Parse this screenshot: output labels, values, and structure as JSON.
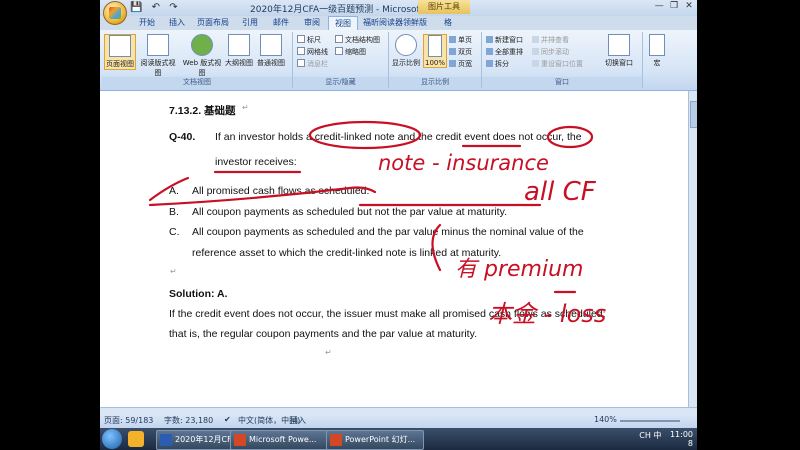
{
  "window": {
    "title": "2020年12月CFA一级百题预测 - Microsoft Word",
    "contextual_tab": "图片工具",
    "quick_access": [
      "save-icon",
      "undo-icon",
      "redo-icon"
    ]
  },
  "tabs": [
    "开始",
    "插入",
    "页面布局",
    "引用",
    "邮件",
    "审阅",
    "视图",
    "福昕阅读器领鲜版",
    "格"
  ],
  "active_tab": "视图",
  "ribbon": {
    "doc_views": {
      "buttons": [
        "页面视图",
        "阅读版式视图",
        "Web 版式视图",
        "大纲视图",
        "普通视图"
      ],
      "label": "文档视图"
    },
    "show_hide": {
      "items": [
        "标尺",
        "网格线",
        "消息栏",
        "文档结构图",
        "缩略图"
      ],
      "label": "显示/隐藏"
    },
    "zoom": {
      "buttons": [
        "显示比例",
        "100%"
      ],
      "small": [
        "单页",
        "双页",
        "页宽"
      ],
      "label": "显示比例"
    },
    "window": {
      "items": [
        "新建窗口",
        "全部重排",
        "拆分",
        "并排查看",
        "同步滚动",
        "重设窗口位置"
      ],
      "switch": "切换窗口",
      "macro": "宏",
      "label": "窗口"
    }
  },
  "document": {
    "heading": "7.13.2.  基础题",
    "question_no": "Q-40.",
    "question_line1": "If  an  investor  holds  a  credit-linked  note  and  the  credit  event  does  not  occur,  the",
    "question_line2": "investor receives:",
    "options": [
      {
        "letter": "A.",
        "lines": [
          "All promised cash flows as scheduled."
        ]
      },
      {
        "letter": "B.",
        "lines": [
          "All coupon payments as scheduled but not the par value at maturity."
        ]
      },
      {
        "letter": "C.",
        "lines": [
          "All  coupon  payments  as  scheduled  and  the  par  value  minus  the  nominal  value  of  the",
          "reference asset to which the credit-linked note is linked at maturity."
        ]
      }
    ],
    "solution_label": "Solution: A.",
    "solution_line1": "If the credit event does not occur, the issuer must make all promised cash flows as scheduled;",
    "solution_line2": "that is, the regular coupon payments and the par value at maturity."
  },
  "annotations": {
    "note_insurance": "note - insurance",
    "all_cf": "all CF",
    "premium": "有 premium",
    "loss": "本金 - loss"
  },
  "status": {
    "page": "页面: 59/183",
    "words": "字数: 23,180",
    "language": "中文(简体，中国)",
    "mode": "插入",
    "zoom": "140%"
  },
  "taskbar": {
    "tasks": [
      "2020年12月CFA...",
      "Microsoft Powe...",
      "PowerPoint 幻灯..."
    ],
    "tray_lang": "CH",
    "ime": "中",
    "time": "11:00",
    "date": "8"
  },
  "colors": {
    "ink": "#c81024",
    "ribbon": "#d5e4f6",
    "selected": "#fbe3a6"
  }
}
